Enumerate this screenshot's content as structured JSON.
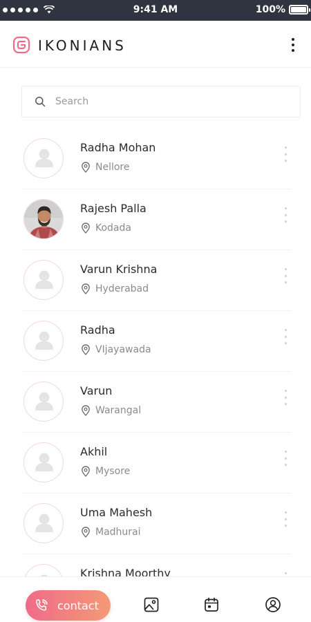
{
  "status_bar": {
    "time": "9:41 AM",
    "battery": "100%",
    "battery_level": 1.0
  },
  "header": {
    "brand": "IKONIANS"
  },
  "search": {
    "placeholder": "Search"
  },
  "contacts": [
    {
      "name": "Radha Mohan",
      "location": "Nellore",
      "avatar": "placeholder-user-icon"
    },
    {
      "name": "Rajesh Palla",
      "location": "Kodada",
      "avatar": "profile-photo"
    },
    {
      "name": "Varun Krishna",
      "location": "Hyderabad",
      "avatar": "placeholder-user-icon"
    },
    {
      "name": "Radha",
      "location": "VIjayawada",
      "avatar": "placeholder-user-icon"
    },
    {
      "name": "Varun",
      "location": "Warangal",
      "avatar": "placeholder-user-icon"
    },
    {
      "name": "Akhil",
      "location": "Mysore",
      "avatar": "placeholder-user-icon"
    },
    {
      "name": "Uma Mahesh",
      "location": "Madhurai",
      "avatar": "placeholder-user-icon"
    },
    {
      "name": "Krishna Moorthy",
      "location": "",
      "avatar": "placeholder-user-icon"
    }
  ],
  "bottom_nav": {
    "contact_label": "contact",
    "items": [
      "phone-icon",
      "gallery-icon",
      "calendar-icon",
      "profile-icon"
    ]
  },
  "colors": {
    "accent_start": "#ef6b89",
    "accent_end": "#f39a76",
    "status_bar": "#2f3440",
    "avatar_ring": "#f5d7dc"
  }
}
